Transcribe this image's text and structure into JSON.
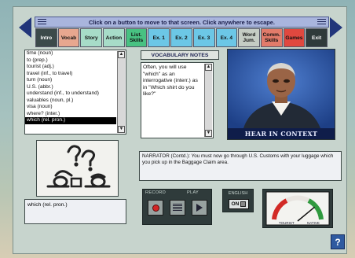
{
  "banner": {
    "text": "Click on a button to move to that screen. Click anywhere to escape."
  },
  "nav": {
    "prev_icon": "triangle-left-icon",
    "next_icon": "triangle-right-icon"
  },
  "tabs": [
    {
      "label": "Intro",
      "color": "#3c4a4a",
      "active": true
    },
    {
      "label": "Vocab",
      "color": "#e7a78f"
    },
    {
      "label": "Story",
      "color": "#a7dcc8"
    },
    {
      "label": "Action",
      "color": "#a7dcc8"
    },
    {
      "label": "List. Skills",
      "color": "#48c282"
    },
    {
      "label": "Ex. 1",
      "color": "#6cc7e6"
    },
    {
      "label": "Ex. 2",
      "color": "#6cc7e6"
    },
    {
      "label": "Ex. 3",
      "color": "#6cc7e6"
    },
    {
      "label": "Ex. 4",
      "color": "#6cc7e6"
    },
    {
      "label": "Word Jum.",
      "color": "#c5ccc4"
    },
    {
      "label": "Comm. Skills",
      "color": "#e27b6a"
    },
    {
      "label": "Games",
      "color": "#e0483f"
    },
    {
      "label": "Exit",
      "color": "#2f3a3a",
      "active": true
    }
  ],
  "vocab_list": {
    "items": [
      "time (noun)",
      "to (prep.)",
      "tourist (adj.)",
      "travel (inf., to travel)",
      "turn (noun)",
      "U.S. (abbr.)",
      "understand (inf., to understand)",
      "valuables (noun, pl.)",
      "visa (noun)",
      "where? (inter.)",
      "which (rel. pron.)"
    ],
    "selected_index": 10
  },
  "notes": {
    "title": "VOCABULARY NOTES",
    "body": "Often, you will use \"which\" as an interrogative (interr.) as in \"Which shirt do you like?\""
  },
  "video": {
    "caption": "HEAR IN CONTEXT"
  },
  "selected_word": "which (rel. pron.)",
  "narrator": {
    "text": "NARRATOR (Contd.): You must now go through U.S. Customs with your luggage which you pick up in the Baggage Claim area."
  },
  "recorder": {
    "record_label": "RECORD",
    "play_label": "PLAY",
    "buttons": [
      "record-icon",
      "waveform-icon",
      "play-icon"
    ]
  },
  "english_toggle": {
    "label": "ENGLISH",
    "value": "ON"
  },
  "gauge": {
    "left_label": "TOURIST",
    "right_label": "NATIVE",
    "level": 0.78
  },
  "help": {
    "label": "?"
  }
}
